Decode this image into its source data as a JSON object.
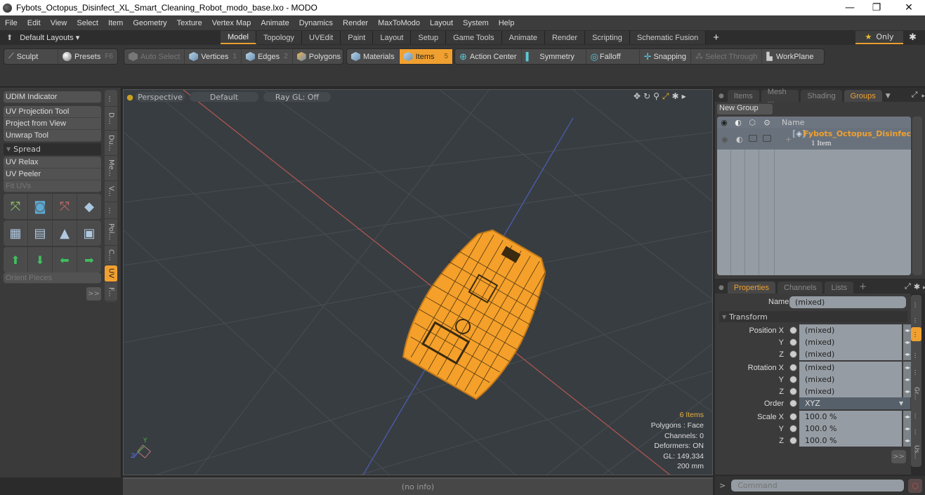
{
  "window": {
    "title": "Fybots_Octopus_Disinfect_XL_Smart_Cleaning_Robot_modo_base.lxo - MODO",
    "minimize": "—",
    "restore": "❐",
    "close": "✕"
  },
  "menu": [
    "File",
    "Edit",
    "View",
    "Select",
    "Item",
    "Geometry",
    "Texture",
    "Vertex Map",
    "Animate",
    "Dynamics",
    "Render",
    "MaxToModo",
    "Layout",
    "System",
    "Help"
  ],
  "layouts": {
    "dropdown": "Default Layouts ▾",
    "tabs": [
      "Model",
      "Topology",
      "UVEdit",
      "Paint",
      "Layout",
      "Setup",
      "Game Tools",
      "Animate",
      "Render",
      "Scripting",
      "Schematic Fusion"
    ],
    "active_tab": "Model",
    "add": "+",
    "only": "Only",
    "star": "★"
  },
  "toolbar": {
    "sculpt": "Sculpt",
    "presets": "Presets",
    "presets_key": "F6",
    "auto_select": "Auto Select",
    "vertices": "Vertices",
    "vertices_key": "1",
    "edges": "Edges",
    "edges_key": "2",
    "polygons": "Polygons",
    "materials": "Materials",
    "items": "Items",
    "items_key": "5",
    "action_center": "Action Center",
    "symmetry": "Symmetry",
    "falloff": "Falloff",
    "snapping": "Snapping",
    "select_through": "Select Through",
    "workplane": "WorkPlane"
  },
  "left_panel": {
    "udim": "UDIM Indicator",
    "uv_projection": "UV Projection Tool",
    "project_from_view": "Project from View",
    "unwrap": "Unwrap Tool",
    "spread": "Spread",
    "uv_relax": "UV Relax",
    "uv_peeler": "UV Peeler",
    "fit_uvs": "Fit UVs",
    "orient_pieces": "Orient Pieces",
    "more": ">>",
    "vtabs": [
      "...",
      "D...",
      "Du...",
      "Me...",
      "V...",
      "...",
      "Pol...",
      "C...",
      "UV",
      "F..."
    ],
    "active_vtab": "UV"
  },
  "viewport": {
    "view": "Perspective",
    "shading": "Default",
    "raygl": "Ray GL: Off",
    "info": {
      "items": "6 Items",
      "polygons": "Polygons : Face",
      "channels": "Channels: 0",
      "deformers": "Deformers: ON",
      "gl": "GL: 149,334",
      "scale": "200 mm"
    },
    "axis_y": "Y",
    "axis_z": "Z",
    "colors": {
      "wire": "#f5a02a",
      "x_axis": "#b5584f",
      "z_axis": "#4d5fb5"
    }
  },
  "status": "(no info)",
  "groups_panel": {
    "tabs": [
      "Items",
      "Mesh ...",
      "Shading",
      "Groups"
    ],
    "active_tab": "Groups",
    "new_group": "New Group",
    "col_name": "Name",
    "group_name": "Fybots_Octopus_Disinfect...",
    "group_count": "1 Item"
  },
  "properties_panel": {
    "tabs": [
      "Properties",
      "Channels",
      "Lists"
    ],
    "active_tab": "Properties",
    "add": "+",
    "name_label": "Name",
    "name_value": "(mixed)",
    "section": "Transform",
    "rows": [
      {
        "label": "Position X",
        "value": "(mixed)"
      },
      {
        "label": "Y",
        "value": "(mixed)"
      },
      {
        "label": "Z",
        "value": "(mixed)"
      },
      {
        "label": "Rotation X",
        "value": "(mixed)"
      },
      {
        "label": "Y",
        "value": "(mixed)"
      },
      {
        "label": "Z",
        "value": "(mixed)"
      },
      {
        "label": "Order",
        "value": "XYZ"
      },
      {
        "label": "Scale X",
        "value": "100.0 %"
      },
      {
        "label": "Y",
        "value": "100.0 %"
      },
      {
        "label": "Z",
        "value": "100.0 %"
      }
    ],
    "more": ">>",
    "vtabs": [
      "...",
      "...",
      "...",
      "...",
      "...",
      "Gr...",
      "...",
      "...",
      "Us..."
    ]
  },
  "command": {
    "prompt": ">",
    "placeholder": "Command"
  }
}
